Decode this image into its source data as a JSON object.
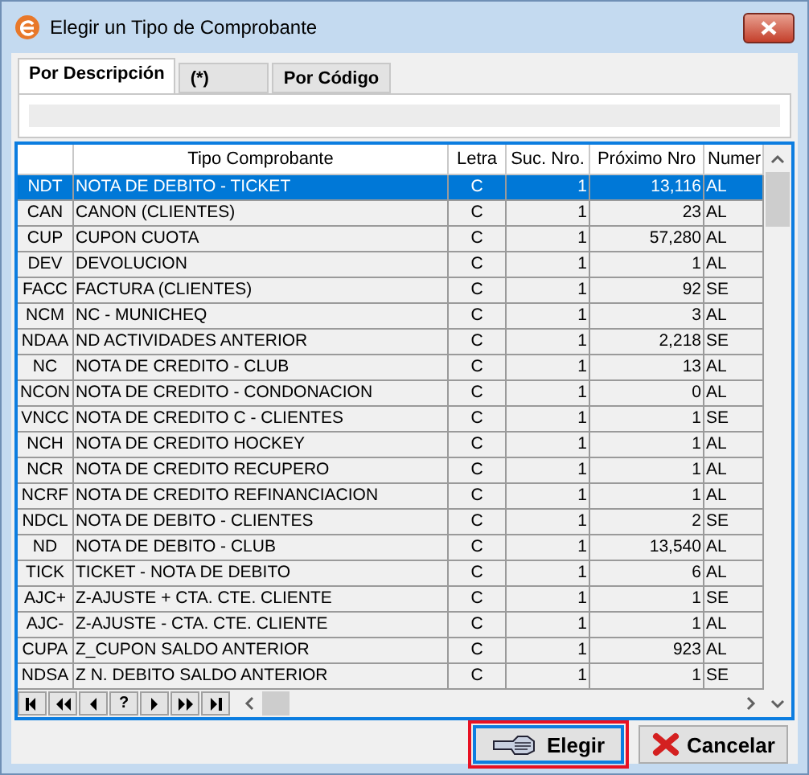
{
  "window": {
    "title": "Elegir un Tipo de Comprobante"
  },
  "tabs": [
    {
      "label": "Por Descripción",
      "selected": true
    },
    {
      "label": "(*)",
      "selected": false
    },
    {
      "label": "Por Código",
      "selected": false
    }
  ],
  "table": {
    "columns": [
      "",
      "Tipo Comprobante",
      "Letra",
      "Suc. Nro.",
      "Próximo Nro",
      "Numer"
    ],
    "rows": [
      {
        "cells": [
          "NDT",
          "NOTA DE DEBITO - TICKET",
          "C",
          "1",
          "13,116",
          "AL"
        ],
        "selected": true
      },
      {
        "cells": [
          "CAN",
          "CANON (CLIENTES)",
          "C",
          "1",
          "23",
          "AL"
        ],
        "selected": false
      },
      {
        "cells": [
          "CUP",
          "CUPON CUOTA",
          "C",
          "1",
          "57,280",
          "AL"
        ],
        "selected": false
      },
      {
        "cells": [
          "DEV",
          "DEVOLUCION",
          "C",
          "1",
          "1",
          "AL"
        ],
        "selected": false
      },
      {
        "cells": [
          "FACC",
          "FACTURA  (CLIENTES)",
          "C",
          "1",
          "92",
          "SE"
        ],
        "selected": false
      },
      {
        "cells": [
          "NCM",
          "NC - MUNICHEQ",
          "C",
          "1",
          "3",
          "AL"
        ],
        "selected": false
      },
      {
        "cells": [
          "NDAA",
          "ND ACTIVIDADES ANTERIOR",
          "C",
          "1",
          "2,218",
          "SE"
        ],
        "selected": false
      },
      {
        "cells": [
          "NC",
          "NOTA DE CREDITO - CLUB",
          "C",
          "1",
          "13",
          "AL"
        ],
        "selected": false
      },
      {
        "cells": [
          "NCON",
          "NOTA DE CREDITO - CONDONACION",
          "C",
          "1",
          "0",
          "AL"
        ],
        "selected": false
      },
      {
        "cells": [
          "VNCC",
          "NOTA DE CREDITO C - CLIENTES",
          "C",
          "1",
          "1",
          "SE"
        ],
        "selected": false
      },
      {
        "cells": [
          "NCH",
          "NOTA DE CREDITO HOCKEY",
          "C",
          "1",
          "1",
          "AL"
        ],
        "selected": false
      },
      {
        "cells": [
          "NCR",
          "NOTA DE CREDITO RECUPERO",
          "C",
          "1",
          "1",
          "AL"
        ],
        "selected": false
      },
      {
        "cells": [
          "NCRF",
          "NOTA DE CREDITO REFINANCIACION",
          "C",
          "1",
          "1",
          "AL"
        ],
        "selected": false
      },
      {
        "cells": [
          "NDCL",
          "NOTA DE DEBITO - CLIENTES",
          "C",
          "1",
          "2",
          "SE"
        ],
        "selected": false
      },
      {
        "cells": [
          "ND",
          "NOTA DE DEBITO - CLUB",
          "C",
          "1",
          "13,540",
          "AL"
        ],
        "selected": false
      },
      {
        "cells": [
          "TICK",
          "TICKET - NOTA DE DEBITO",
          "C",
          "1",
          "6",
          "AL"
        ],
        "selected": false
      },
      {
        "cells": [
          "AJC+",
          "Z-AJUSTE + CTA. CTE. CLIENTE",
          "C",
          "1",
          "1",
          "SE"
        ],
        "selected": false
      },
      {
        "cells": [
          "AJC-",
          "Z-AJUSTE - CTA. CTE. CLIENTE",
          "C",
          "1",
          "1",
          "AL"
        ],
        "selected": false
      },
      {
        "cells": [
          "CUPA",
          "Z_CUPON  SALDO ANTERIOR",
          "C",
          "1",
          "923",
          "AL"
        ],
        "selected": false
      },
      {
        "cells": [
          "NDSA",
          "Z  N. DEBITO SALDO ANTERIOR",
          "C",
          "1",
          "1",
          "SE"
        ],
        "selected": false
      }
    ]
  },
  "navigator": [
    {
      "kind": "first"
    },
    {
      "kind": "prev_page"
    },
    {
      "kind": "prev"
    },
    {
      "kind": "text",
      "label": "?"
    },
    {
      "kind": "next"
    },
    {
      "kind": "next_page"
    },
    {
      "kind": "last"
    }
  ],
  "buttons": [
    {
      "kind": "choose",
      "label": "Elegir",
      "focused": true
    },
    {
      "kind": "cancel",
      "label": "Cancelar",
      "focused": false
    }
  ]
}
